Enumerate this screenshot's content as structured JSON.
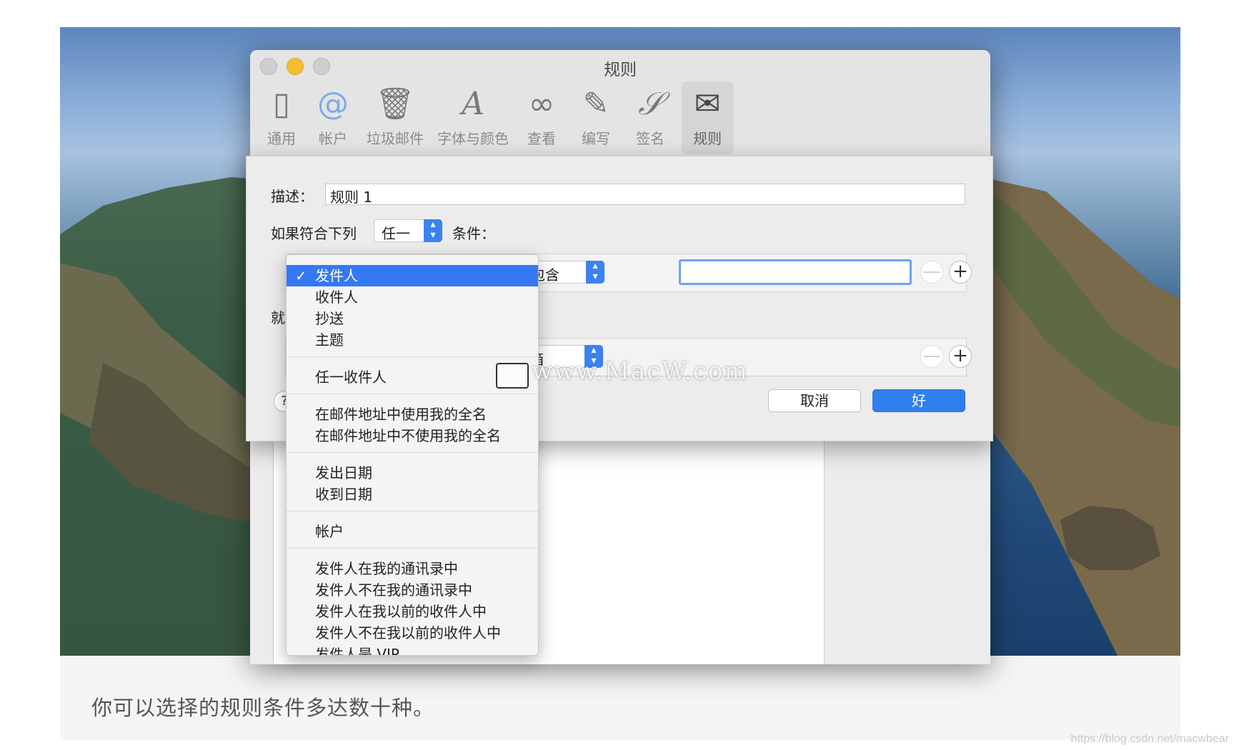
{
  "window": {
    "title": "规则",
    "toolbar": [
      {
        "label": "通用",
        "icon": "switch-icon"
      },
      {
        "label": "帐户",
        "icon": "at-icon"
      },
      {
        "label": "垃圾邮件",
        "icon": "trash-icon"
      },
      {
        "label": "字体与颜色",
        "icon": "font-icon"
      },
      {
        "label": "查看",
        "icon": "glasses-icon"
      },
      {
        "label": "编写",
        "icon": "pencil-icon"
      },
      {
        "label": "签名",
        "icon": "signature-icon"
      },
      {
        "label": "规则",
        "icon": "rules-icon"
      }
    ]
  },
  "sheet": {
    "description_label": "描述：",
    "description_value": "规则 1",
    "if_label": "如果符合下列",
    "match_value": "任一",
    "conditions_label": "条件：",
    "operator_value": "包含",
    "then_label": "就",
    "action_value": "邮箱",
    "minus": "—",
    "plus": "+",
    "help": "?",
    "cancel_label": "取消",
    "ok_label": "好"
  },
  "menu": {
    "check": "✓",
    "items": [
      "发件人",
      "收件人",
      "抄送",
      "主题",
      "任一收件人",
      "在邮件地址中使用我的全名",
      "在邮件地址中不使用我的全名",
      "发出日期",
      "收到日期",
      "帐户",
      "发件人在我的通讯录中",
      "发件人不在我的通讯录中",
      "发件人在我以前的收件人中",
      "发件人不在我以前的收件人中",
      "发件人是 VIP"
    ]
  },
  "watermark": "www.MacW.com",
  "caption": "你可以选择的规则条件多达数十种。",
  "footer_link": "https://blog.csdn.net/macwbear",
  "colors": {
    "accent": "#3478f6",
    "traffic_yellow": "#f6bd2f"
  }
}
